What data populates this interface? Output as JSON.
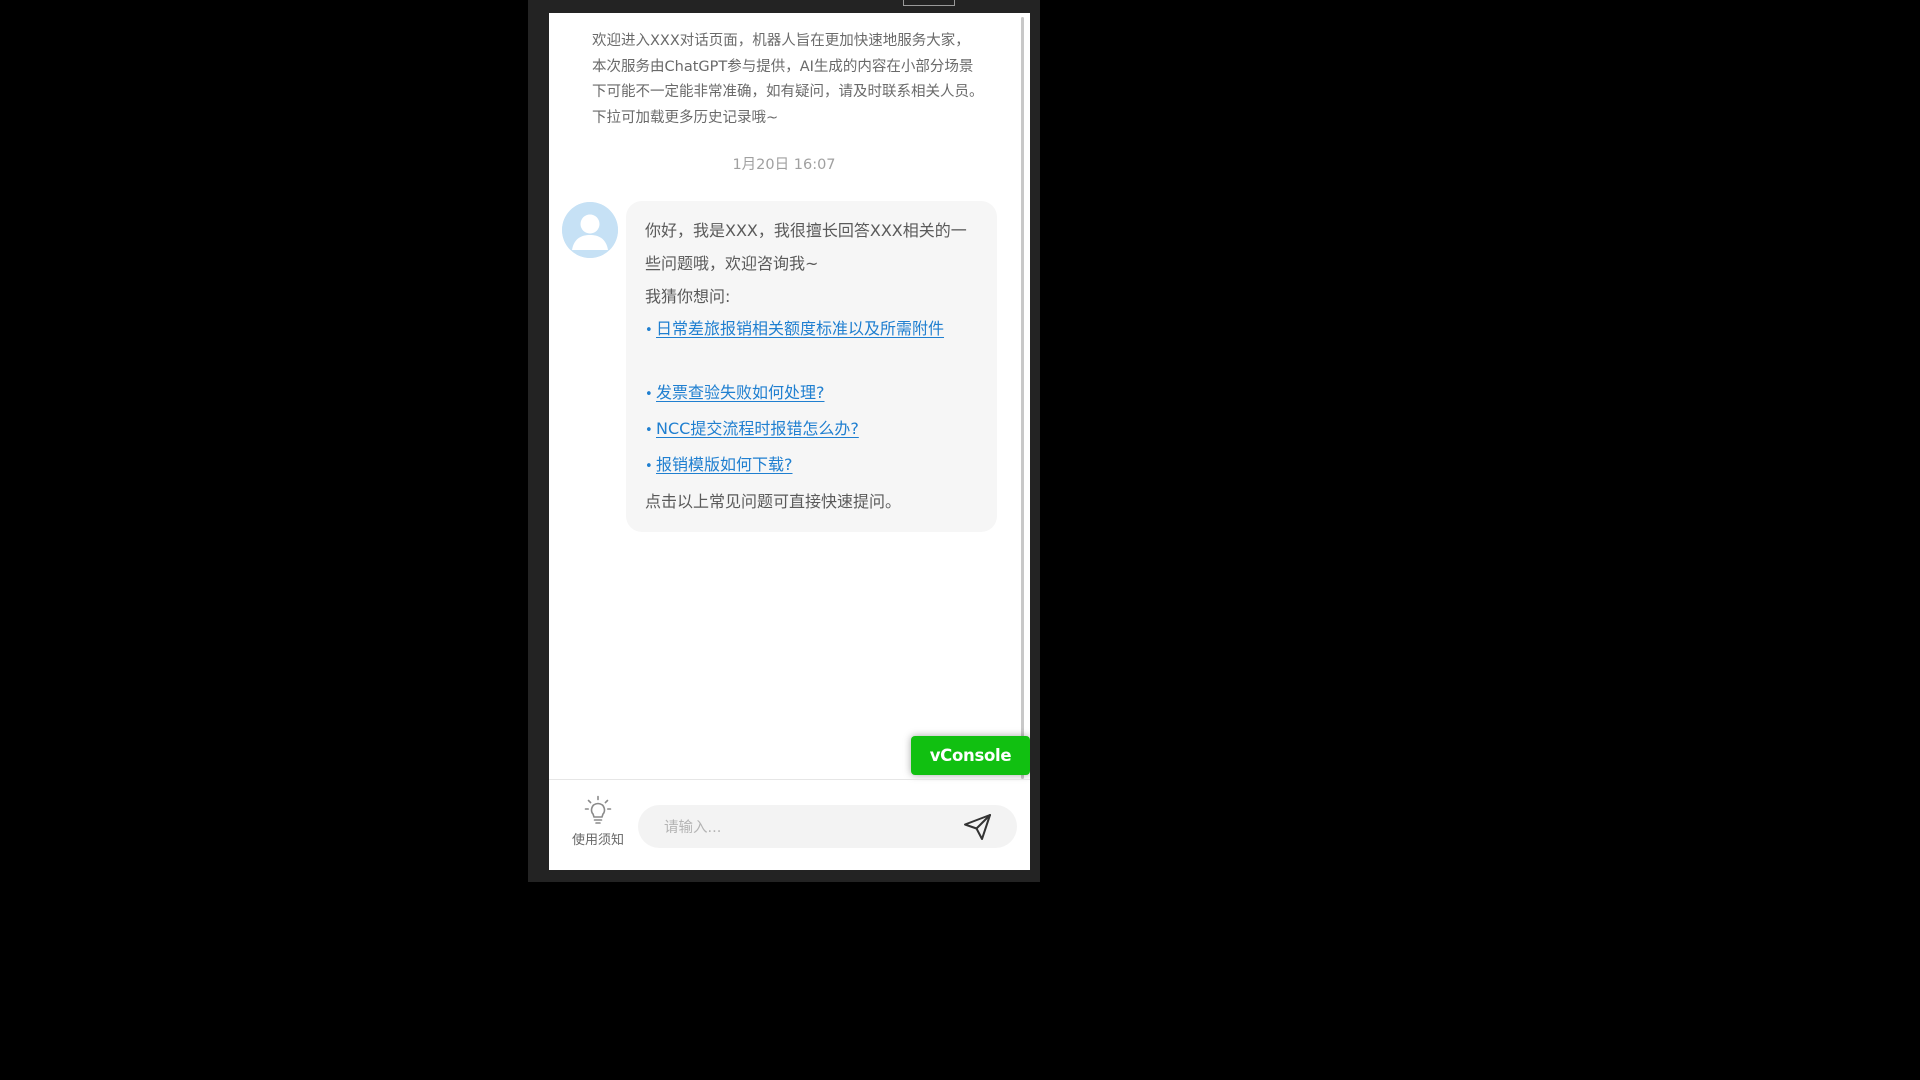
{
  "intro": {
    "text": "欢迎进入XXX对话页面，机器人旨在更加快速地服务大家，本次服务由ChatGPT参与提供，AI生成的内容在小部分场景下可能不一定能非常准确，如有疑问，请及时联系相关人员。下拉可加载更多历史记录哦~"
  },
  "timestamp": "1月20日 16:07",
  "bot_message": {
    "greeting": "你好，我是XXX，我很擅长回答XXX相关的一些问题哦，欢迎咨询我~",
    "guess_label": "我猜你想问:",
    "suggestions": [
      "日常差旅报销相关额度标准以及所需附件",
      "发票查验失败如何处理?",
      "NCC提交流程时报错怎么办?",
      "报销模版如何下载?"
    ],
    "footer": "点击以上常见问题可直接快速提问。"
  },
  "vconsole": {
    "label": "vConsole",
    "color": "#11c011"
  },
  "bottom_bar": {
    "notice_label": "使用须知",
    "notice_icon": "lightbulb-icon",
    "input_placeholder": "请输入...",
    "send_icon": "send-icon"
  },
  "colors": {
    "link": "#1f7fd0",
    "bubble_bg": "#f6f6f6",
    "avatar_bg": "#c6e1f5"
  }
}
